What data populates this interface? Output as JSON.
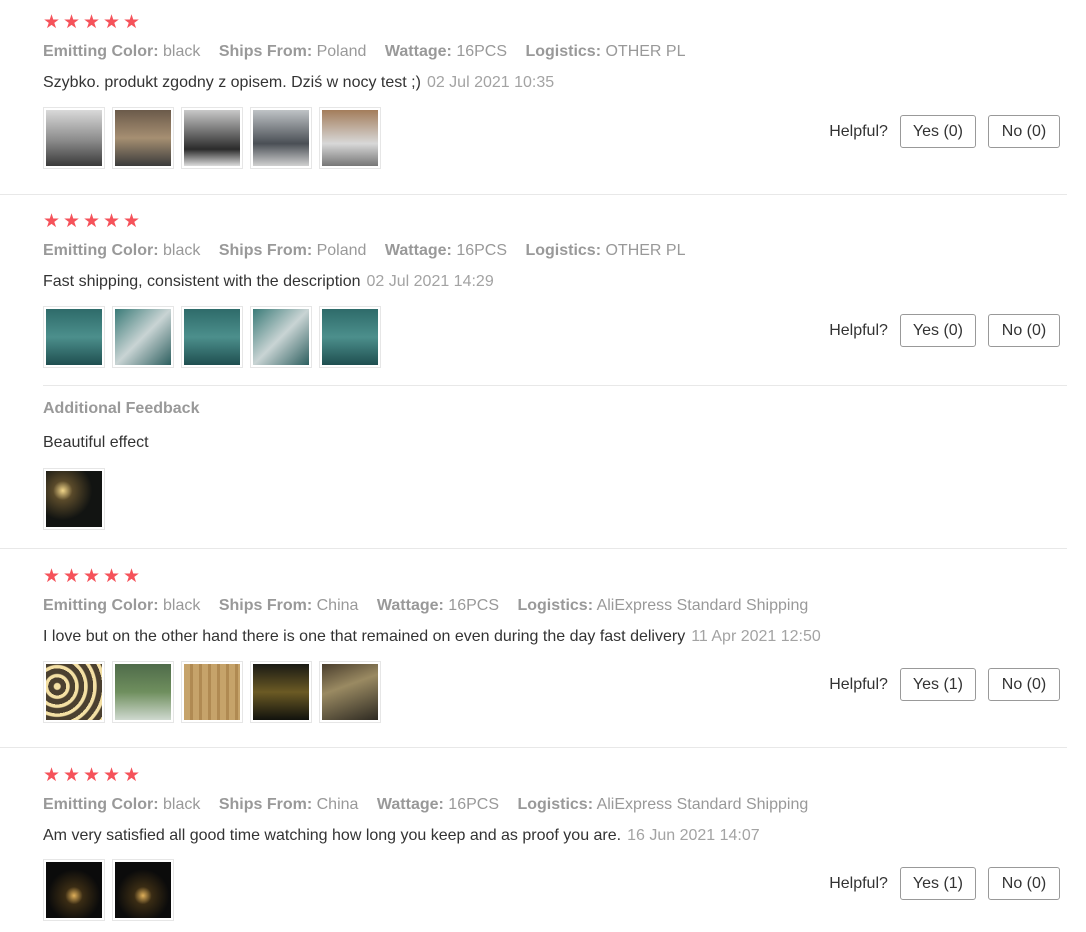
{
  "reviews": [
    {
      "stars": 5,
      "attrs": [
        {
          "key": "Emitting Color:",
          "value": "black"
        },
        {
          "key": "Ships From:",
          "value": "Poland"
        },
        {
          "key": "Wattage:",
          "value": "16PCS"
        },
        {
          "key": "Logistics:",
          "value": "OTHER PL"
        }
      ],
      "text": "Szybko. produkt zgodny z opisem. Dziś w nocy test ;)",
      "date": "02 Jul 2021 10:35",
      "helpful_label": "Helpful?",
      "yes_label": "Yes (0)",
      "no_label": "No (0)",
      "thumb_count": 5
    },
    {
      "stars": 5,
      "attrs": [
        {
          "key": "Emitting Color:",
          "value": "black"
        },
        {
          "key": "Ships From:",
          "value": "Poland"
        },
        {
          "key": "Wattage:",
          "value": "16PCS"
        },
        {
          "key": "Logistics:",
          "value": "OTHER PL"
        }
      ],
      "text": "Fast shipping, consistent with the description",
      "date": "02 Jul 2021 14:29",
      "helpful_label": "Helpful?",
      "yes_label": "Yes (0)",
      "no_label": "No (0)",
      "thumb_count": 5,
      "additional": {
        "title": "Additional Feedback",
        "text": "Beautiful effect",
        "thumb_count": 1
      }
    },
    {
      "stars": 5,
      "attrs": [
        {
          "key": "Emitting Color:",
          "value": "black"
        },
        {
          "key": "Ships From:",
          "value": "China"
        },
        {
          "key": "Wattage:",
          "value": "16PCS"
        },
        {
          "key": "Logistics:",
          "value": "AliExpress Standard Shipping"
        }
      ],
      "text": "I love but on the other hand there is one that remained on even during the day fast delivery",
      "date": "11 Apr 2021 12:50",
      "helpful_label": "Helpful?",
      "yes_label": "Yes (1)",
      "no_label": "No (0)",
      "thumb_count": 5
    },
    {
      "stars": 5,
      "attrs": [
        {
          "key": "Emitting Color:",
          "value": "black"
        },
        {
          "key": "Ships From:",
          "value": "China"
        },
        {
          "key": "Wattage:",
          "value": "16PCS"
        },
        {
          "key": "Logistics:",
          "value": "AliExpress Standard Shipping"
        }
      ],
      "text": "Am very satisfied all good time watching how long you keep and as proof you are.",
      "date": "16 Jun 2021 14:07",
      "helpful_label": "Helpful?",
      "yes_label": "Yes (1)",
      "no_label": "No (0)",
      "thumb_count": 2
    }
  ],
  "colors": {
    "star": "#f5525a",
    "attr_text": "#999999",
    "date_text": "#a3a3a3",
    "body_text": "#333333",
    "divider": "#e8e8e8"
  }
}
